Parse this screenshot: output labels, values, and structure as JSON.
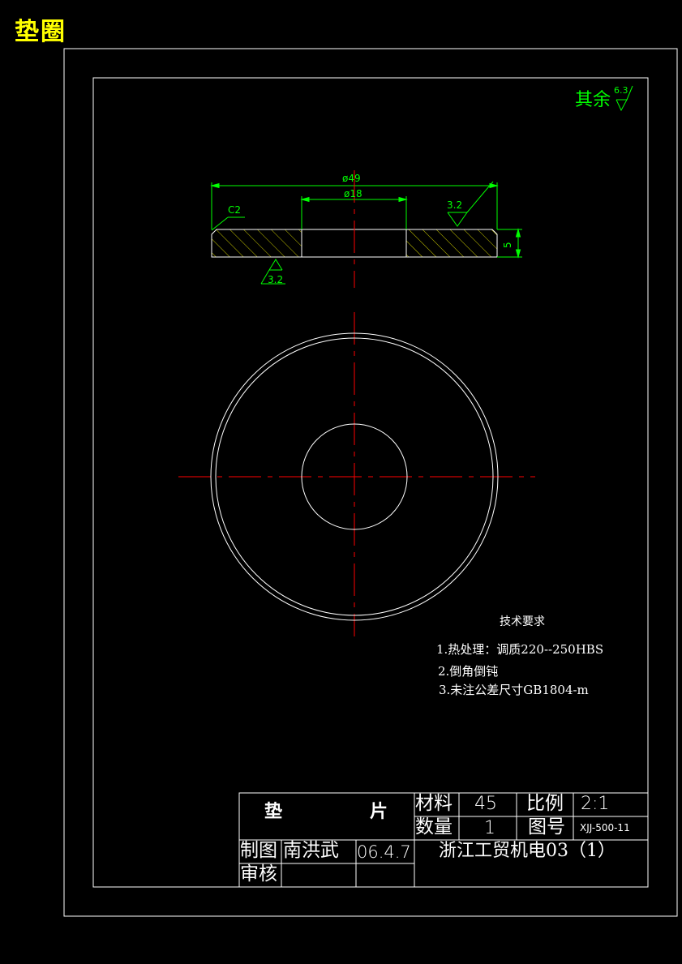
{
  "page_title": "垫圈",
  "surface_finish_note": {
    "text": "其余",
    "value": "6.3"
  },
  "dimensions": {
    "outer_diameter": "ø49",
    "inner_diameter": "ø18",
    "chamfer": "C2",
    "thickness": "5",
    "roughness_top": "3.2",
    "roughness_bottom": "3.2"
  },
  "tech_requirements": {
    "heading": "技术要求",
    "items": [
      "1.热处理：调质220--250HBS",
      "2.倒角倒钝",
      "3.未注公差尺寸GB1804-m"
    ]
  },
  "title_block": {
    "part_name_1": "垫",
    "part_name_2": "片",
    "material_label": "材料",
    "material_value": "45",
    "scale_label": "比例",
    "scale_value": "2:1",
    "quantity_label": "数量",
    "quantity_value": "1",
    "drawing_no_label": "图号",
    "drawing_no_value": "XJJ-500-11",
    "drawn_by_label": "制图",
    "drawn_by_name": "南洪武",
    "date": "06.4.7",
    "organization": "浙江工贸机电03（1）",
    "review_label": "审核"
  },
  "colors": {
    "background": "#000000",
    "outline": "#ffffff",
    "dimension": "#00ff00",
    "centerline": "#ff0000",
    "hatch": "#c8c800",
    "title": "#ffff00"
  }
}
